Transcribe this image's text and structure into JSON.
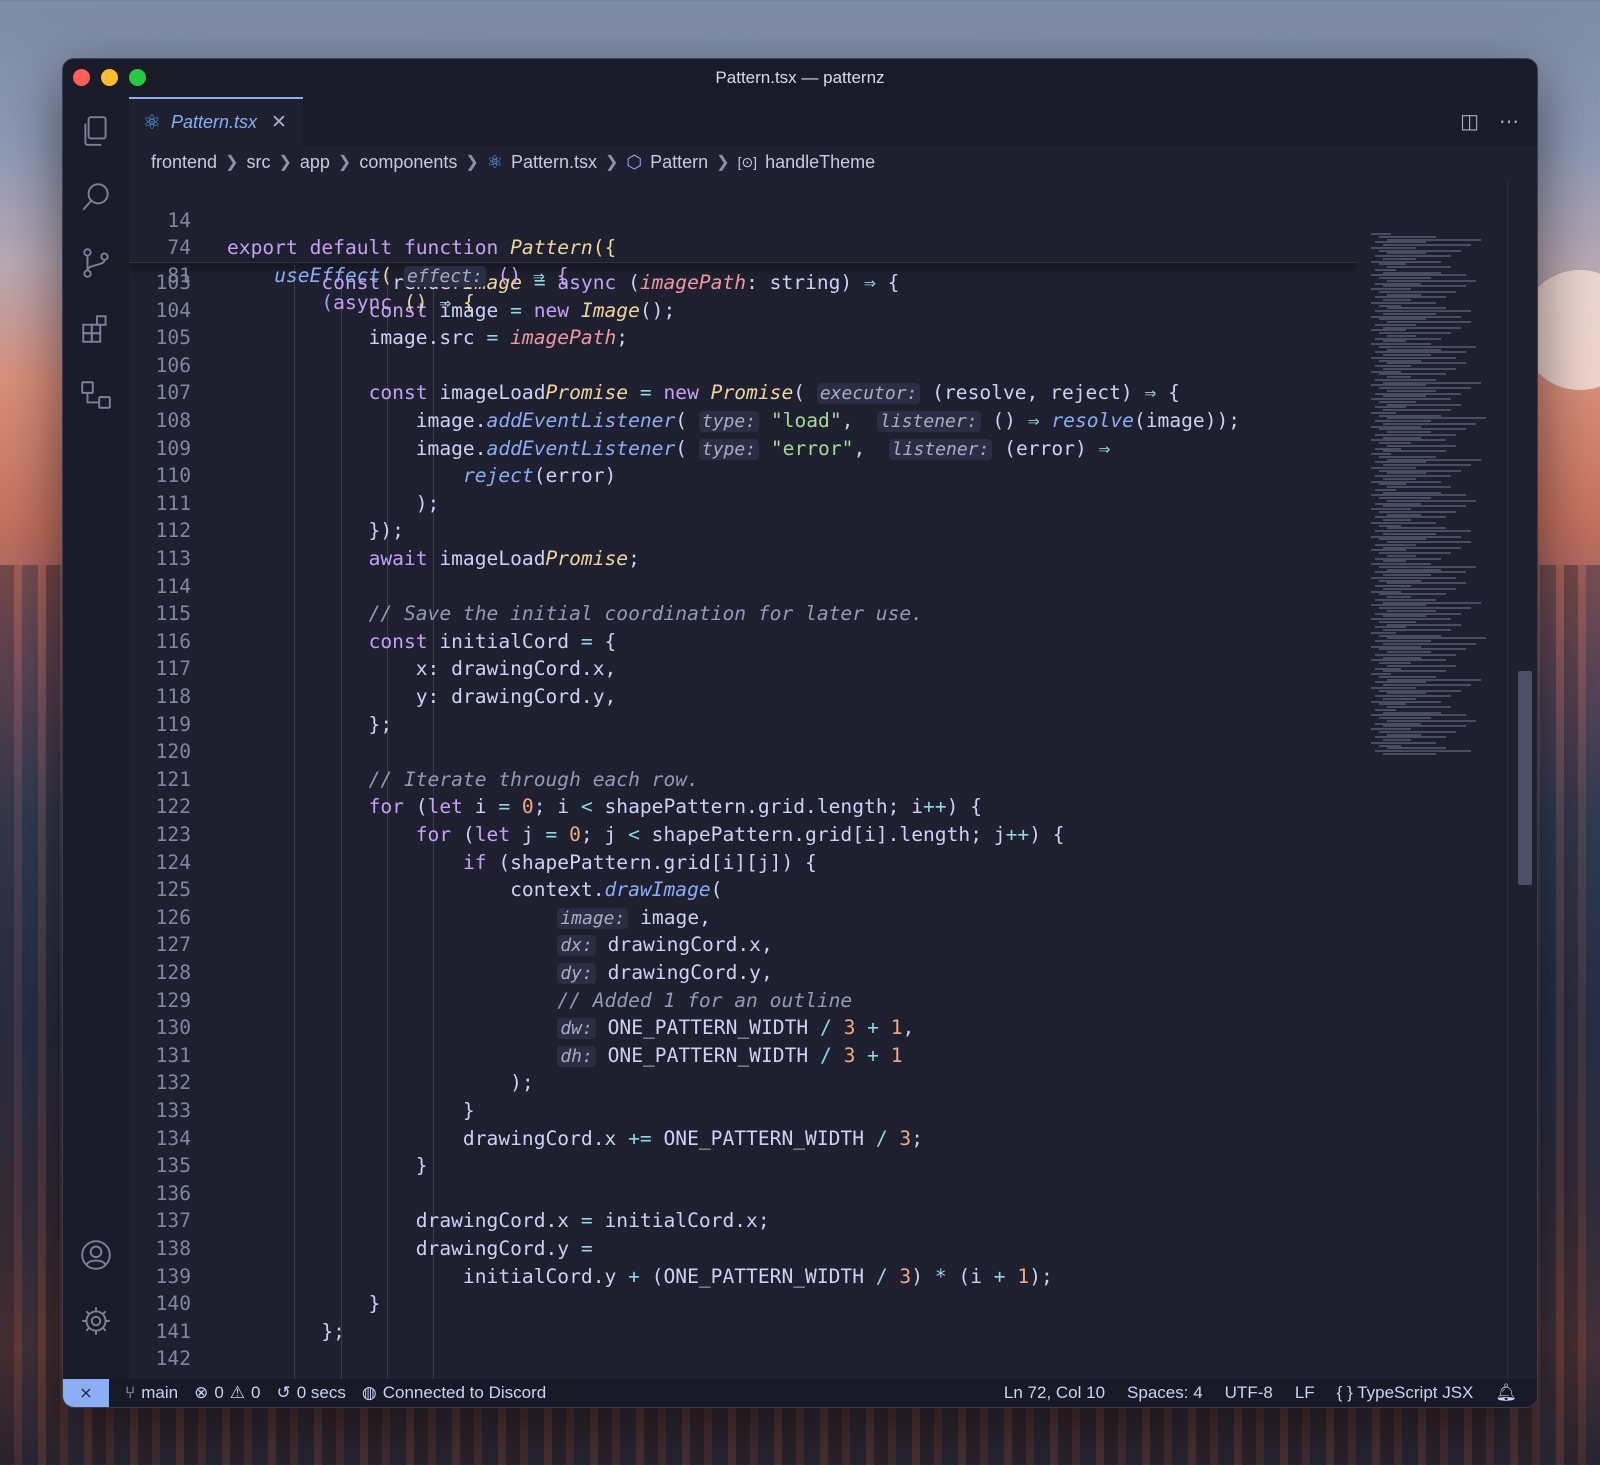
{
  "window": {
    "title": "Pattern.tsx — patternz"
  },
  "tab": {
    "label": "Pattern.tsx",
    "close": "✕"
  },
  "breadcrumb": [
    "frontend",
    "src",
    "app",
    "components",
    "Pattern.tsx",
    "Pattern",
    "handleTheme"
  ],
  "activity_icons": [
    "explorer-icon",
    "search-icon",
    "source-control-icon",
    "extensions-icon",
    "remote-explorer-icon",
    "account-icon",
    "settings-gear-icon"
  ],
  "colors": {
    "keyword": "#c6a0f6",
    "function": "#8aadf4",
    "type": "#eed49f",
    "param": "#ee99a0",
    "string": "#a6da95",
    "number": "#f5a97f",
    "comment": "#939ab7",
    "editor_bg": "#1e2030"
  },
  "sticky_lines": [
    {
      "n": "14",
      "text": "export default function Pattern({"
    },
    {
      "n": "74",
      "text": "    useEffect( effect: () ⇒ {"
    },
    {
      "n": "81",
      "text": "        (async () ⇒ {"
    }
  ],
  "code_lines": [
    {
      "n": "103",
      "text": "const renderImage = async (imagePath: string) ⇒ {"
    },
    {
      "n": "104",
      "text": "const image = new Image();"
    },
    {
      "n": "105",
      "text": "image.src = imagePath;"
    },
    {
      "n": "106",
      "text": ""
    },
    {
      "n": "107",
      "text": "const imageLoadPromise = new Promise( executor: (resolve, reject) ⇒ {"
    },
    {
      "n": "108",
      "text": "image.addEventListener( type: \"load\",  listener: () ⇒ resolve(image));"
    },
    {
      "n": "109",
      "text": "image.addEventListener( type: \"error\",  listener: (error) ⇒"
    },
    {
      "n": "110",
      "text": "reject(error)"
    },
    {
      "n": "111",
      "text": ");"
    },
    {
      "n": "112",
      "text": "});"
    },
    {
      "n": "113",
      "text": "await imageLoadPromise;"
    },
    {
      "n": "114",
      "text": ""
    },
    {
      "n": "115",
      "text": "// Save the initial coordination for later use."
    },
    {
      "n": "116",
      "text": "const initialCord = {"
    },
    {
      "n": "117",
      "text": "x: drawingCord.x,"
    },
    {
      "n": "118",
      "text": "y: drawingCord.y,"
    },
    {
      "n": "119",
      "text": "};"
    },
    {
      "n": "120",
      "text": ""
    },
    {
      "n": "121",
      "text": "// Iterate through each row."
    },
    {
      "n": "122",
      "text": "for (let i = 0; i < shapePattern.grid.length; i++) {"
    },
    {
      "n": "123",
      "text": "for (let j = 0; j < shapePattern.grid[i].length; j++) {"
    },
    {
      "n": "124",
      "text": "if (shapePattern.grid[i][j]) {"
    },
    {
      "n": "125",
      "text": "context.drawImage("
    },
    {
      "n": "126",
      "text": "image: image,"
    },
    {
      "n": "127",
      "text": "dx: drawingCord.x,"
    },
    {
      "n": "128",
      "text": "dy: drawingCord.y,"
    },
    {
      "n": "129",
      "text": "// Added 1 for an outline"
    },
    {
      "n": "130",
      "text": "dw: ONE_PATTERN_WIDTH / 3 + 1,"
    },
    {
      "n": "131",
      "text": "dh: ONE_PATTERN_WIDTH / 3 + 1"
    },
    {
      "n": "132",
      "text": ");"
    },
    {
      "n": "133",
      "text": "}"
    },
    {
      "n": "134",
      "text": "drawingCord.x += ONE_PATTERN_WIDTH / 3;"
    },
    {
      "n": "135",
      "text": "}"
    },
    {
      "n": "136",
      "text": ""
    },
    {
      "n": "137",
      "text": "drawingCord.x = initialCord.x;"
    },
    {
      "n": "138",
      "text": "drawingCord.y ="
    },
    {
      "n": "139",
      "text": "initialCord.y + (ONE_PATTERN_WIDTH / 3) * (i + 1);"
    },
    {
      "n": "140",
      "text": "}"
    },
    {
      "n": "141",
      "text": "};"
    },
    {
      "n": "142",
      "text": ""
    }
  ],
  "statusbar": {
    "remote": "⨯",
    "branch": "main",
    "errors": "0",
    "warnings": "0",
    "timer": "0 secs",
    "discord": "Connected to Discord",
    "position": "Ln 72, Col 10",
    "spaces": "Spaces: 4",
    "encoding": "UTF-8",
    "eol": "LF",
    "language": "TypeScript JSX"
  }
}
